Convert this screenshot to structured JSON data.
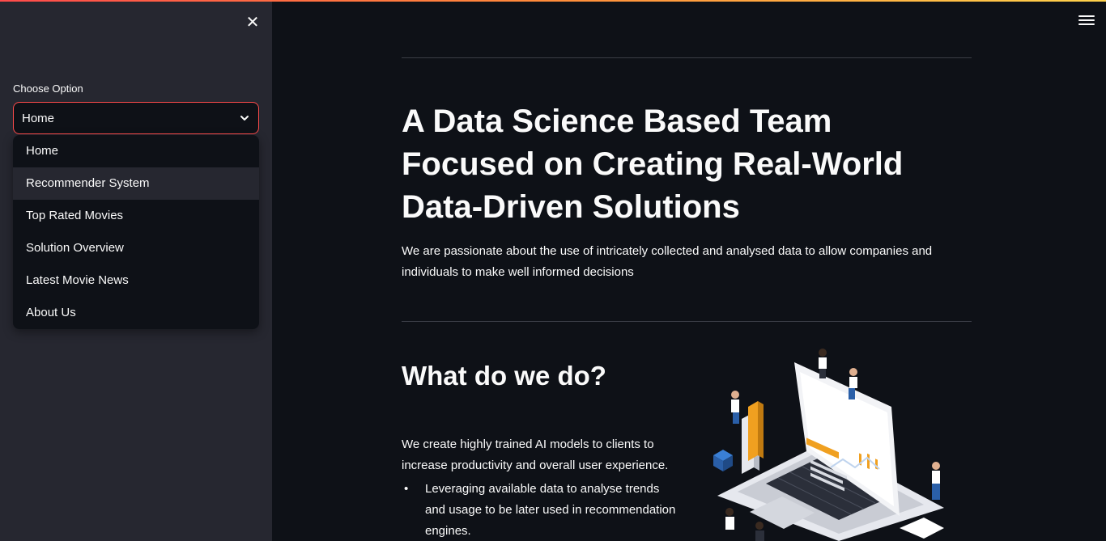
{
  "sidebar": {
    "close_icon": "close-icon",
    "choose_label": "Choose Option",
    "select": {
      "value": "Home",
      "icon": "chevron-down-icon"
    },
    "options": [
      {
        "label": "Home"
      },
      {
        "label": "Recommender System"
      },
      {
        "label": "Top Rated Movies"
      },
      {
        "label": "Solution Overview"
      },
      {
        "label": "Latest Movie News"
      },
      {
        "label": "About Us"
      }
    ],
    "hovered_option": "Recommender System"
  },
  "header": {
    "menu_icon": "hamburger-menu-icon"
  },
  "main": {
    "hero_title": "A Data Science Based Team Focused on Creating Real-World Data-Driven Solutions",
    "hero_text": "We are passionate about the use of intricately collected and analysed data to allow companies and individuals to make well informed decisions",
    "what_title": "What do we do?",
    "what_text": "We create highly trained AI models to clients to increase productivity and overall user experience.",
    "bullets": [
      "Leveraging available data to analyse trends and usage to be later used in recommendation engines."
    ]
  },
  "colors": {
    "background": "#0e1117",
    "sidebar": "#262730",
    "accent": "#ff4b4b",
    "text": "#fafafa"
  }
}
